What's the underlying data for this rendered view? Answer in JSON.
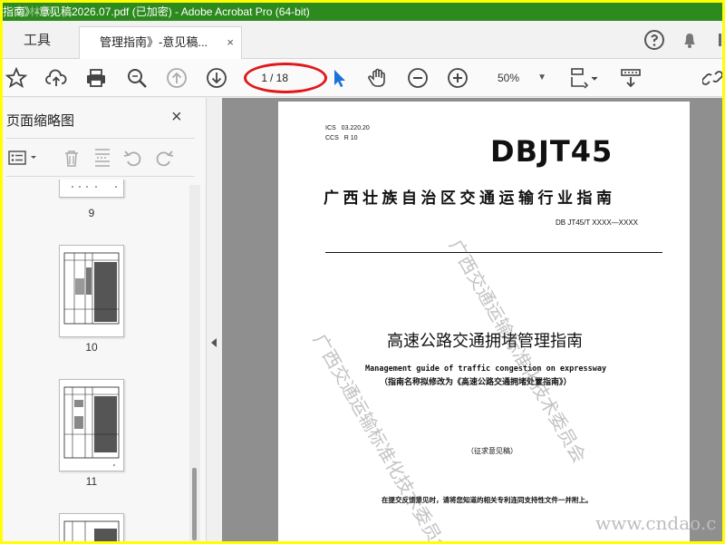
{
  "window": {
    "title": "指南》-意见稿2026.07.pdf   (已加密)   - Adobe Acrobat Pro (64-bit)",
    "watermark_top": "道 林 网"
  },
  "tabs": {
    "tools_label": "工具",
    "doc_label": "管理指南》-意见稿...",
    "close_symbol": "×"
  },
  "toolbar": {
    "current_page": "1",
    "page_total": "/ 18",
    "zoom": "50%",
    "zoom_caret": "▼"
  },
  "panel": {
    "title": "页面缩略图",
    "close_symbol": "×",
    "thumbnails": [
      {
        "label": "9"
      },
      {
        "label": "10"
      },
      {
        "label": "11"
      },
      {
        "label": ""
      }
    ]
  },
  "document": {
    "ics_line": "ICS",
    "ics_code": "03.220.20",
    "ccs_line": "CCS",
    "ccs_code": "R 10",
    "code_big": "DBJT45",
    "province": "广西壮族自治区交通运输行业指南",
    "std_number": "DB JT45/T XXXX—XXXX",
    "title_cn": "高速公路交通拥堵管理指南",
    "title_en": "Management guide of traffic congestion on expressway",
    "rename_note": "（指南名称拟修改为《高速公路交通拥堵处置指南》）",
    "draft_label": "（征求意见稿）",
    "footnote": "在提交反馈意见时，请将您知道的相关专利连同支持性文件一并附上。",
    "watermark_1": "广西交通运输标准化技术委员会",
    "watermark_2": "广西交通运输标准化技术委员会"
  },
  "site_watermark": "www.cndao.c",
  "colors": {
    "title_bar": "#2d8a1e",
    "frame": "#ffff00",
    "highlight": "#e0191b",
    "doc_bg": "#8f8f8f"
  },
  "icons": [
    "star-icon",
    "upload-icon",
    "print-icon",
    "search-icon",
    "prev-page-icon",
    "next-page-icon",
    "select-cursor-icon",
    "hand-icon",
    "zoom-out-icon",
    "zoom-in-icon",
    "fit-page-icon",
    "scroll-mode-icon",
    "link-icon",
    "help-icon",
    "bell-icon"
  ]
}
